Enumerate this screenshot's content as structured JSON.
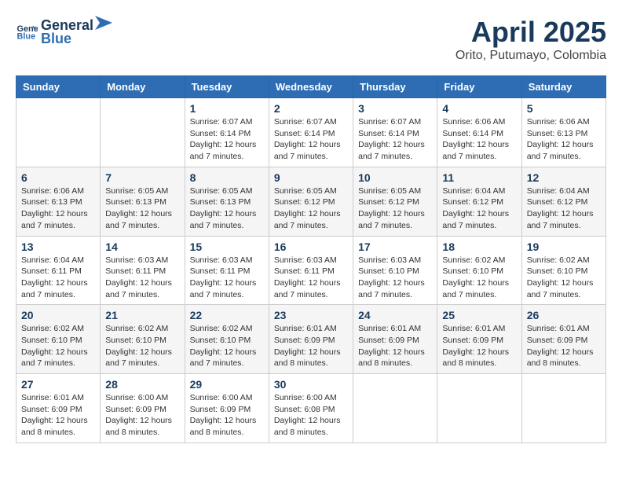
{
  "header": {
    "logo_general": "General",
    "logo_blue": "Blue",
    "month_title": "April 2025",
    "location": "Orito, Putumayo, Colombia"
  },
  "weekdays": [
    "Sunday",
    "Monday",
    "Tuesday",
    "Wednesday",
    "Thursday",
    "Friday",
    "Saturday"
  ],
  "weeks": [
    [
      {
        "day": "",
        "info": ""
      },
      {
        "day": "",
        "info": ""
      },
      {
        "day": "1",
        "info": "Sunrise: 6:07 AM\nSunset: 6:14 PM\nDaylight: 12 hours\nand 7 minutes."
      },
      {
        "day": "2",
        "info": "Sunrise: 6:07 AM\nSunset: 6:14 PM\nDaylight: 12 hours\nand 7 minutes."
      },
      {
        "day": "3",
        "info": "Sunrise: 6:07 AM\nSunset: 6:14 PM\nDaylight: 12 hours\nand 7 minutes."
      },
      {
        "day": "4",
        "info": "Sunrise: 6:06 AM\nSunset: 6:14 PM\nDaylight: 12 hours\nand 7 minutes."
      },
      {
        "day": "5",
        "info": "Sunrise: 6:06 AM\nSunset: 6:13 PM\nDaylight: 12 hours\nand 7 minutes."
      }
    ],
    [
      {
        "day": "6",
        "info": "Sunrise: 6:06 AM\nSunset: 6:13 PM\nDaylight: 12 hours\nand 7 minutes."
      },
      {
        "day": "7",
        "info": "Sunrise: 6:05 AM\nSunset: 6:13 PM\nDaylight: 12 hours\nand 7 minutes."
      },
      {
        "day": "8",
        "info": "Sunrise: 6:05 AM\nSunset: 6:13 PM\nDaylight: 12 hours\nand 7 minutes."
      },
      {
        "day": "9",
        "info": "Sunrise: 6:05 AM\nSunset: 6:12 PM\nDaylight: 12 hours\nand 7 minutes."
      },
      {
        "day": "10",
        "info": "Sunrise: 6:05 AM\nSunset: 6:12 PM\nDaylight: 12 hours\nand 7 minutes."
      },
      {
        "day": "11",
        "info": "Sunrise: 6:04 AM\nSunset: 6:12 PM\nDaylight: 12 hours\nand 7 minutes."
      },
      {
        "day": "12",
        "info": "Sunrise: 6:04 AM\nSunset: 6:12 PM\nDaylight: 12 hours\nand 7 minutes."
      }
    ],
    [
      {
        "day": "13",
        "info": "Sunrise: 6:04 AM\nSunset: 6:11 PM\nDaylight: 12 hours\nand 7 minutes."
      },
      {
        "day": "14",
        "info": "Sunrise: 6:03 AM\nSunset: 6:11 PM\nDaylight: 12 hours\nand 7 minutes."
      },
      {
        "day": "15",
        "info": "Sunrise: 6:03 AM\nSunset: 6:11 PM\nDaylight: 12 hours\nand 7 minutes."
      },
      {
        "day": "16",
        "info": "Sunrise: 6:03 AM\nSunset: 6:11 PM\nDaylight: 12 hours\nand 7 minutes."
      },
      {
        "day": "17",
        "info": "Sunrise: 6:03 AM\nSunset: 6:10 PM\nDaylight: 12 hours\nand 7 minutes."
      },
      {
        "day": "18",
        "info": "Sunrise: 6:02 AM\nSunset: 6:10 PM\nDaylight: 12 hours\nand 7 minutes."
      },
      {
        "day": "19",
        "info": "Sunrise: 6:02 AM\nSunset: 6:10 PM\nDaylight: 12 hours\nand 7 minutes."
      }
    ],
    [
      {
        "day": "20",
        "info": "Sunrise: 6:02 AM\nSunset: 6:10 PM\nDaylight: 12 hours\nand 7 minutes."
      },
      {
        "day": "21",
        "info": "Sunrise: 6:02 AM\nSunset: 6:10 PM\nDaylight: 12 hours\nand 7 minutes."
      },
      {
        "day": "22",
        "info": "Sunrise: 6:02 AM\nSunset: 6:10 PM\nDaylight: 12 hours\nand 7 minutes."
      },
      {
        "day": "23",
        "info": "Sunrise: 6:01 AM\nSunset: 6:09 PM\nDaylight: 12 hours\nand 8 minutes."
      },
      {
        "day": "24",
        "info": "Sunrise: 6:01 AM\nSunset: 6:09 PM\nDaylight: 12 hours\nand 8 minutes."
      },
      {
        "day": "25",
        "info": "Sunrise: 6:01 AM\nSunset: 6:09 PM\nDaylight: 12 hours\nand 8 minutes."
      },
      {
        "day": "26",
        "info": "Sunrise: 6:01 AM\nSunset: 6:09 PM\nDaylight: 12 hours\nand 8 minutes."
      }
    ],
    [
      {
        "day": "27",
        "info": "Sunrise: 6:01 AM\nSunset: 6:09 PM\nDaylight: 12 hours\nand 8 minutes."
      },
      {
        "day": "28",
        "info": "Sunrise: 6:00 AM\nSunset: 6:09 PM\nDaylight: 12 hours\nand 8 minutes."
      },
      {
        "day": "29",
        "info": "Sunrise: 6:00 AM\nSunset: 6:09 PM\nDaylight: 12 hours\nand 8 minutes."
      },
      {
        "day": "30",
        "info": "Sunrise: 6:00 AM\nSunset: 6:08 PM\nDaylight: 12 hours\nand 8 minutes."
      },
      {
        "day": "",
        "info": ""
      },
      {
        "day": "",
        "info": ""
      },
      {
        "day": "",
        "info": ""
      }
    ]
  ]
}
